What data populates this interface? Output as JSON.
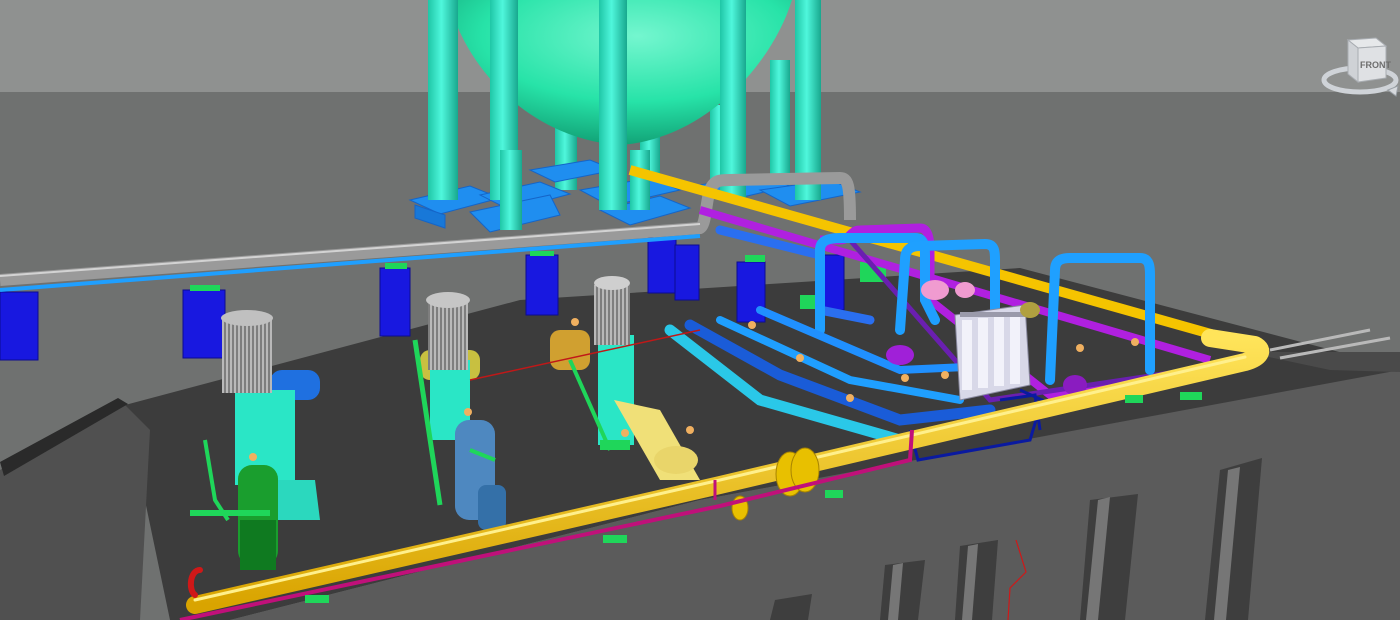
{
  "viewport": {
    "background_sky": "#8f9190",
    "background_ground": "#6f7170"
  },
  "viewcube": {
    "face_label": "FRONT",
    "icon": "viewcube-icon"
  },
  "colors": {
    "sphere": "#27e3a8",
    "columns": "#2ae6c6",
    "pedestals": "#1f8ef0",
    "supports": "#1414e0",
    "grey_pipe": "#9a9a9a",
    "blue_pipe": "#1f9fff",
    "yellow_pipe": "#f5c400",
    "magenta_pipe": "#b020e0",
    "dark_pink_pipe": "#c0107a",
    "cyan_pipe": "#2ac8e8",
    "slab_top": "#3d3d3d",
    "slab_edge": "#585858",
    "pump_green": "#1fd65a",
    "motor_grey": "#9c9c9c"
  }
}
